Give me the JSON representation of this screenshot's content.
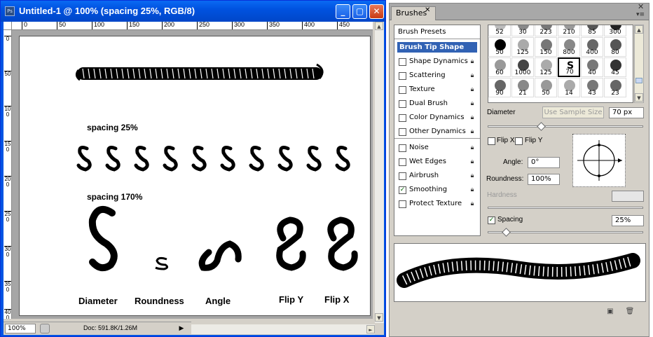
{
  "document": {
    "title": "Untitled-1 @ 100% (spacing 25%, RGB/8)",
    "ruler_top_labels": [
      "0",
      "50",
      "100",
      "150",
      "200",
      "250",
      "300",
      "350",
      "400",
      "450"
    ],
    "ruler_left_labels": [
      "0",
      "50",
      "100",
      "150",
      "200",
      "250",
      "300",
      "350",
      "400"
    ],
    "canvas_labels": {
      "spacing_25": "spacing 25%",
      "spacing_170": "spacing 170%",
      "diameter": "Diameter",
      "roundness": "Roundness",
      "angle": "Angle",
      "flip_y": "Flip Y",
      "flip_x": "Flip X"
    },
    "status": {
      "zoom": "100%",
      "doc_info": "Doc: 591.8K/1.26M"
    }
  },
  "brushes_panel": {
    "tab_label": "Brushes",
    "presets_label": "Brush Presets",
    "tip_shape_label": "Brush Tip Shape",
    "options": [
      {
        "label": "Shape Dynamics",
        "checked": false
      },
      {
        "label": "Scattering",
        "checked": false
      },
      {
        "label": "Texture",
        "checked": false
      },
      {
        "label": "Dual Brush",
        "checked": false
      },
      {
        "label": "Color Dynamics",
        "checked": false
      },
      {
        "label": "Other Dynamics",
        "checked": false
      },
      {
        "label": "Noise",
        "checked": false
      },
      {
        "label": "Wet Edges",
        "checked": false
      },
      {
        "label": "Airbrush",
        "checked": false
      },
      {
        "label": "Smoothing",
        "checked": true
      },
      {
        "label": "Protect Texture",
        "checked": false
      }
    ],
    "tips": [
      "52",
      "30",
      "223",
      "210",
      "85",
      "300",
      "50",
      "125",
      "150",
      "800",
      "400",
      "80",
      "60",
      "1000",
      "125",
      "70",
      "40",
      "45",
      "90",
      "21",
      "50",
      "14",
      "43",
      "23"
    ],
    "diameter_label": "Diameter",
    "use_sample_size": "Use Sample Size",
    "diameter_value": "70 px",
    "flip_x": "Flip X",
    "flip_y": "Flip Y",
    "angle_label": "Angle:",
    "angle_value": "0°",
    "roundness_label": "Roundness:",
    "roundness_value": "100%",
    "hardness_label": "Hardness",
    "spacing_label": "Spacing",
    "spacing_value": "25%",
    "spacing_checked": "✓",
    "smoothing_checked": "✓"
  },
  "colors": {
    "title_bar": "#0054e3",
    "selection": "#3162b4"
  }
}
